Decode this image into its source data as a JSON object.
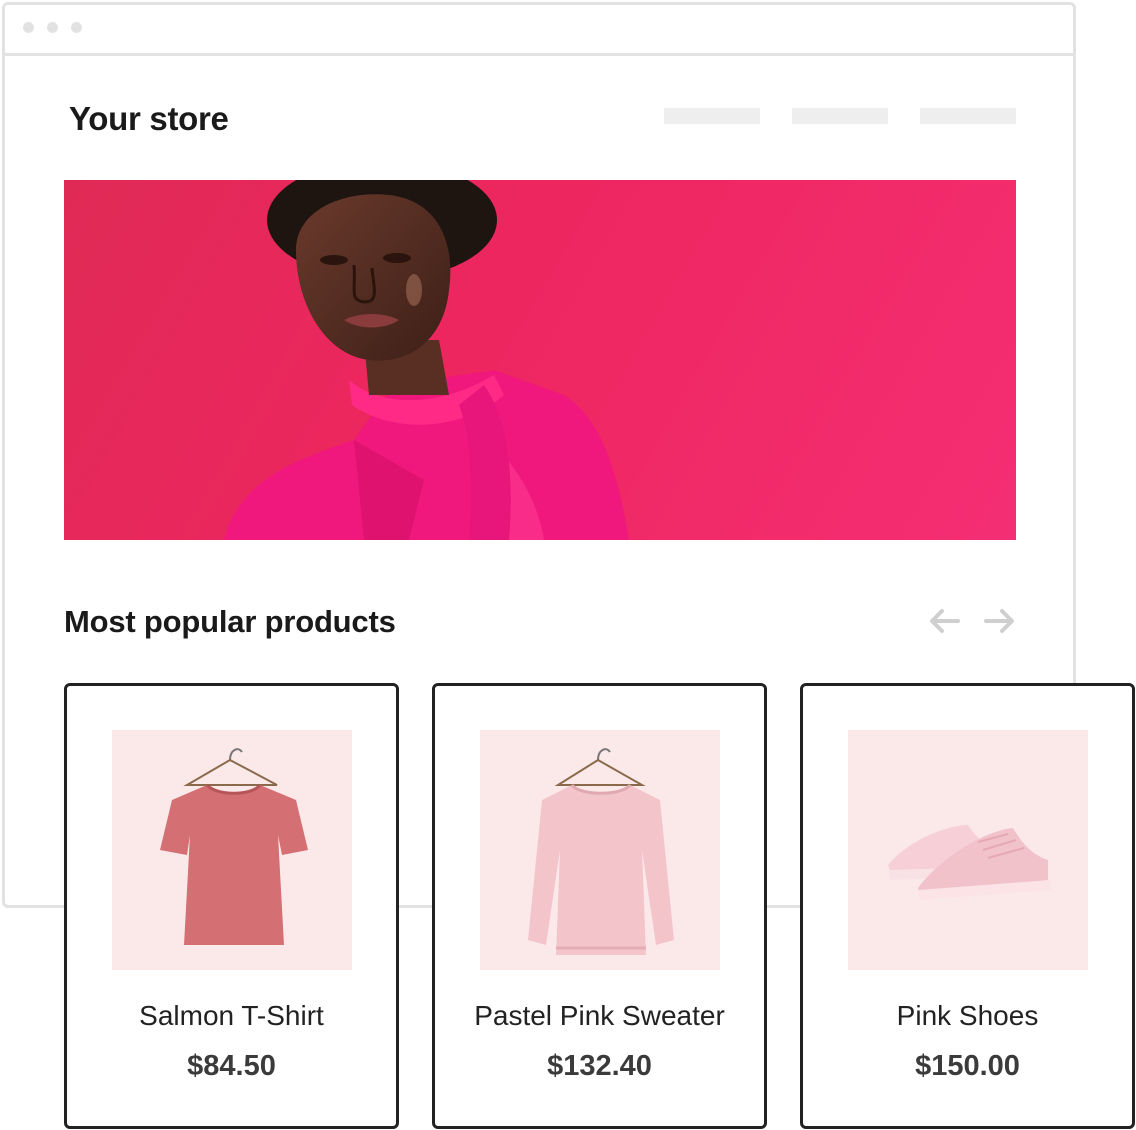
{
  "header": {
    "title": "Your store"
  },
  "section": {
    "title": "Most popular products"
  },
  "colors": {
    "hero_bg": "#ee2660",
    "card_bg": "#fbe9ea",
    "frame": "#e2e2e2"
  },
  "products": [
    {
      "name": "Salmon T-Shirt",
      "price": "$84.50",
      "icon": "tshirt-icon"
    },
    {
      "name": "Pastel Pink Sweater",
      "price": "$132.40",
      "icon": "sweater-icon"
    },
    {
      "name": "Pink Shoes",
      "price": "$150.00",
      "icon": "sneakers-icon"
    }
  ]
}
